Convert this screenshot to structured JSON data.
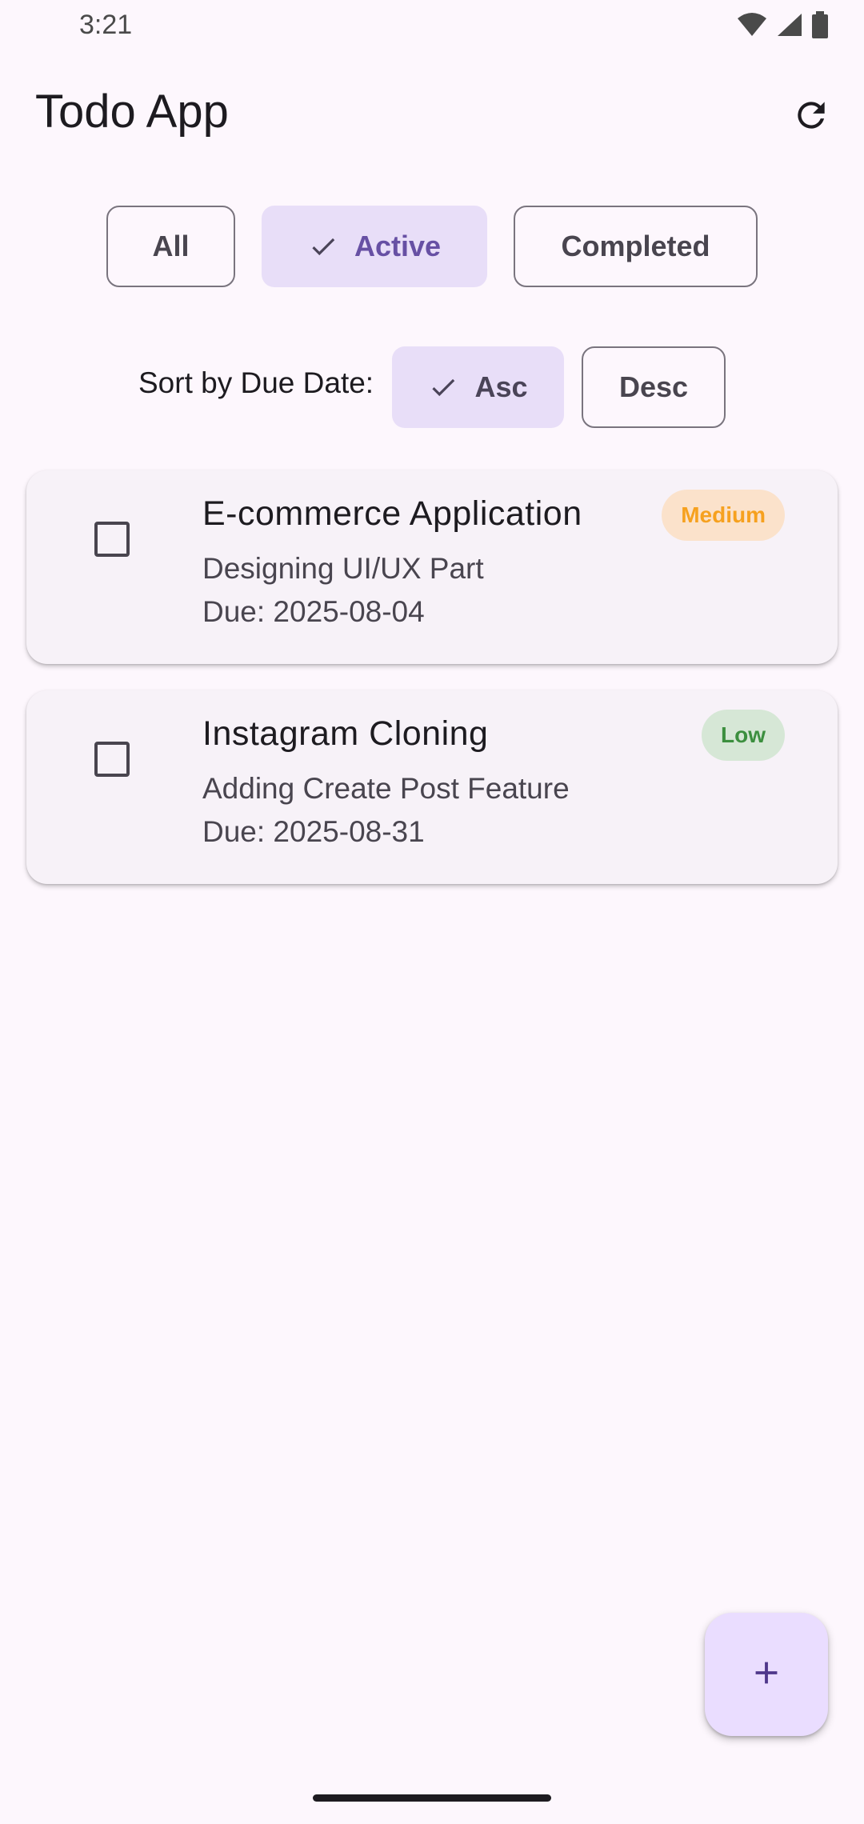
{
  "status_bar": {
    "time": "3:21",
    "icons": [
      "wifi-icon",
      "cellular-signal-icon",
      "battery-icon"
    ]
  },
  "app_bar": {
    "title": "Todo App",
    "action_icon": "refresh-icon"
  },
  "filters": {
    "options": [
      "All",
      "Active",
      "Completed"
    ],
    "selected": "Active"
  },
  "sort": {
    "label": "Sort by Due Date:",
    "options": [
      "Asc",
      "Desc"
    ],
    "selected": "Asc"
  },
  "todos": [
    {
      "title": "E-commerce Application",
      "description": "Designing UI/UX Part",
      "due": "Due: 2025-08-04",
      "priority": "Medium",
      "completed": false
    },
    {
      "title": "Instagram Cloning",
      "description": "Adding Create Post Feature",
      "due": "Due: 2025-08-31",
      "priority": "Low",
      "completed": false
    }
  ],
  "fab": {
    "icon": "add-icon"
  },
  "colors": {
    "background": "#fdf7fd",
    "selected_chip": "#e8def8",
    "accent": "#6750a4",
    "card": "#f7f2f8",
    "medium_badge_bg": "#fbe2cb",
    "medium_badge_text": "#f6a11f",
    "low_badge_bg": "#d6e7d6",
    "low_badge_text": "#3c8f3f",
    "fab": "#eaddff"
  }
}
